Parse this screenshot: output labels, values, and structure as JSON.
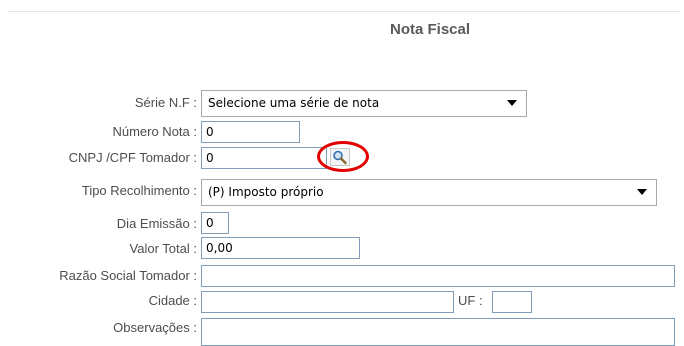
{
  "form": {
    "title": "Nota Fiscal",
    "serie": {
      "label": "Série N.F :",
      "selected": "Selecione uma série de nota"
    },
    "numero_nota": {
      "label": "Número Nota :",
      "value": "0"
    },
    "cnpj": {
      "label": "CNPJ /CPF Tomador :",
      "value": "0",
      "lookup_icon": "magnifier-icon"
    },
    "tipo_recolhimento": {
      "label": "Tipo Recolhimento :",
      "selected": "(P) Imposto próprio"
    },
    "dia_emissao": {
      "label": "Dia Emissão :",
      "value": "0"
    },
    "valor_total": {
      "label": "Valor Total :",
      "value": "0,00"
    },
    "razao_social": {
      "label": "Razão Social Tomador :",
      "value": ""
    },
    "cidade": {
      "label": "Cidade :",
      "value": ""
    },
    "uf": {
      "label": "UF :",
      "value": ""
    },
    "observacoes": {
      "label": "Observações :",
      "value": ""
    }
  },
  "colors": {
    "highlight_circle": "#e20000",
    "field_border": "#7f9db9",
    "label_text": "#4d4d4d"
  }
}
